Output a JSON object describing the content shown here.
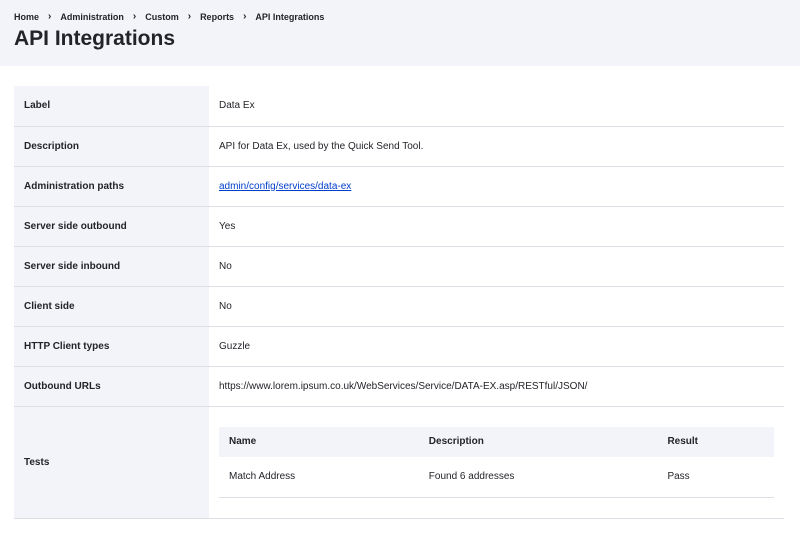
{
  "breadcrumb": [
    "Home",
    "Administration",
    "Custom",
    "Reports",
    "API Integrations"
  ],
  "breadcrumb_separator": "›",
  "page_title": "API Integrations",
  "details": {
    "label": {
      "label": "Label",
      "value": "Data Ex"
    },
    "description": {
      "label": "Description",
      "value": "API for Data Ex, used by the Quick Send Tool."
    },
    "admin_paths": {
      "label": "Administration paths",
      "value": "admin/config/services/data-ex"
    },
    "server_outbound": {
      "label": "Server side outbound",
      "value": "Yes"
    },
    "server_inbound": {
      "label": "Server side inbound",
      "value": "No"
    },
    "client_side": {
      "label": "Client side",
      "value": "No"
    },
    "http_client_types": {
      "label": "HTTP Client types",
      "value": "Guzzle"
    },
    "outbound_urls": {
      "label": "Outbound URLs",
      "value": "https://www.lorem.ipsum.co.uk/WebServices/Service/DATA-EX.asp/RESTful/JSON/"
    },
    "tests": {
      "label": "Tests"
    }
  },
  "tests_table": {
    "headers": {
      "name": "Name",
      "description": "Description",
      "result": "Result"
    },
    "rows": [
      {
        "name": "Match Address",
        "description": "Found 6 addresses",
        "result": "Pass"
      }
    ]
  }
}
